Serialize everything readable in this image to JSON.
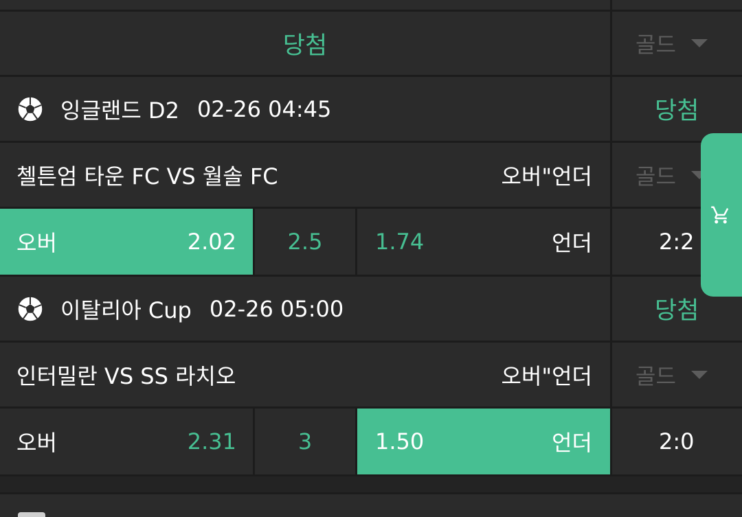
{
  "header": {
    "status": "당첨",
    "grade": "골드"
  },
  "matches": [
    {
      "league": "잉글랜드 D2",
      "datetime": "02-26 04:45",
      "status": "당첨",
      "teams": "첼튼엄 타운 FC VS 월솔 FC",
      "market": "오버\"언더",
      "grade": "골드",
      "over_label": "오버",
      "over_odds": "2.02",
      "line": "2.5",
      "under_odds": "1.74",
      "under_label": "언더",
      "score": "2:2",
      "selected": "over"
    },
    {
      "league": "이탈리아 Cup",
      "datetime": "02-26 05:00",
      "status": "당첨",
      "teams": "인터밀란 VS SS 라치오",
      "market": "오버\"언더",
      "grade": "골드",
      "over_label": "오버",
      "over_odds": "2.31",
      "line": "3",
      "under_odds": "1.50",
      "under_label": "언더",
      "score": "2:0",
      "selected": "under"
    }
  ],
  "cart": {
    "icon": "cart-icon"
  },
  "colors": {
    "accent": "#47bf92",
    "cell": "#2b2b2b",
    "divider": "#1c1c1c",
    "muted": "#5c5c5c"
  }
}
